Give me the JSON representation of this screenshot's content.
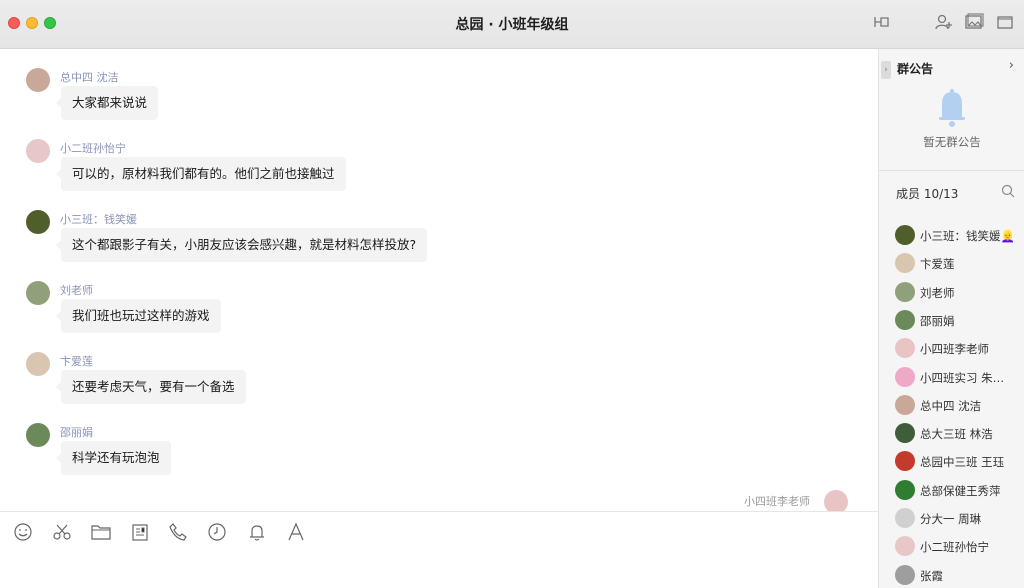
{
  "window": {
    "title": "总园 · 小班年级组"
  },
  "messages": [
    {
      "sender": "总中四 沈洁",
      "text": "大家都来说说",
      "avatar": "#c9a89a"
    },
    {
      "sender": "小二班孙怡宁",
      "text": "可以的，原材料我们都有的。他们之前也接触过",
      "avatar": "#e7c7c7"
    },
    {
      "sender": "小三班：钱笑媛",
      "text": "这个都跟影子有关，小朋友应该会感兴趣，就是材料怎样投放?",
      "avatar": "#4f5e2a"
    },
    {
      "sender": "刘老师",
      "text": "我们班也玩过这样的游戏",
      "avatar": "#8fa07a"
    },
    {
      "sender": "卞爱莲",
      "text": "还要考虑天气，要有一个备选",
      "avatar": "#d9c6b0"
    },
    {
      "sender": "邵丽娟",
      "text": "科学还有玩泡泡",
      "avatar": "#6b8a5a"
    }
  ],
  "self_message": {
    "sender": "小四班李老师",
    "avatar": "#e9c4c4"
  },
  "side": {
    "announcement_title": "群公告",
    "announcement_empty": "暂无群公告",
    "members_title": "成员 10/13",
    "members": [
      {
        "name": "小三班：钱笑媛👱‍♀️",
        "avatar": "#4f5e2a"
      },
      {
        "name": "卞爱莲",
        "avatar": "#d9c6b0"
      },
      {
        "name": "刘老师",
        "avatar": "#8fa07a"
      },
      {
        "name": "邵丽娟",
        "avatar": "#6b8a5a"
      },
      {
        "name": "小四班李老师",
        "avatar": "#e9c4c4"
      },
      {
        "name": "小四班实习 朱…",
        "avatar": "#f0a8c8"
      },
      {
        "name": "总中四 沈洁",
        "avatar": "#c9a89a"
      },
      {
        "name": "总大三班 林浩",
        "avatar": "#3f5d3a"
      },
      {
        "name": "总园中三班 王珏",
        "avatar": "#c23b2c"
      },
      {
        "name": "总部保健王秀萍",
        "avatar": "#2e7d32"
      },
      {
        "name": "分大一 周琳",
        "avatar": "#d0d0d0"
      },
      {
        "name": "小二班孙怡宁",
        "avatar": "#e7c7c7"
      },
      {
        "name": "张霞",
        "avatar": "#9e9e9e"
      }
    ]
  },
  "toolbar": {
    "icons": [
      "smile-icon",
      "scissors-icon",
      "folder-icon",
      "document-icon",
      "phone-icon",
      "clock-icon",
      "bell-icon",
      "font-icon"
    ]
  },
  "colors": {
    "sender_name": "#8a93b8",
    "bubble": "#f3f3f3",
    "sidebar_bg": "#f5f5f5",
    "bell_blue": "#a9c9f0"
  }
}
